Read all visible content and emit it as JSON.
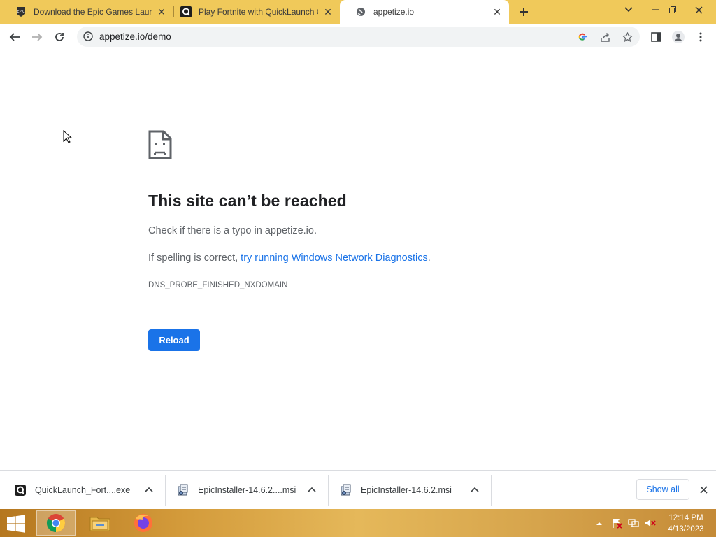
{
  "tabs": [
    {
      "title": "Download the Epic Games Launcher",
      "favicon": "epic-games-icon",
      "active": false
    },
    {
      "title": "Play Fortnite with QuickLaunch C",
      "favicon": "quicklaunch-icon",
      "active": false
    },
    {
      "title": "appetize.io",
      "favicon": "globe-icon",
      "active": true
    }
  ],
  "address_bar": {
    "url": "appetize.io/demo"
  },
  "error_page": {
    "title": "This site can’t be reached",
    "line1": "Check if there is a typo in appetize.io.",
    "line2_prefix": "If spelling is correct, ",
    "line2_link": "try running Windows Network Diagnostics",
    "line2_suffix": ".",
    "error_code": "DNS_PROBE_FINISHED_NXDOMAIN",
    "reload_label": "Reload"
  },
  "downloads": [
    {
      "name": "QuickLaunch_Fort....exe",
      "icon": "quicklaunch-icon"
    },
    {
      "name": "EpicInstaller-14.6.2....msi",
      "icon": "installer-icon"
    },
    {
      "name": "EpicInstaller-14.6.2.msi",
      "icon": "installer-icon"
    }
  ],
  "download_shelf": {
    "show_all_label": "Show all"
  },
  "taskbar": {
    "apps": [
      "chrome-icon",
      "file-explorer-icon",
      "firefox-icon"
    ],
    "clock_time": "12:14 PM",
    "clock_date": "4/13/2023"
  },
  "colors": {
    "tab_strip": "#f0c95a",
    "accent": "#1a73e8"
  }
}
